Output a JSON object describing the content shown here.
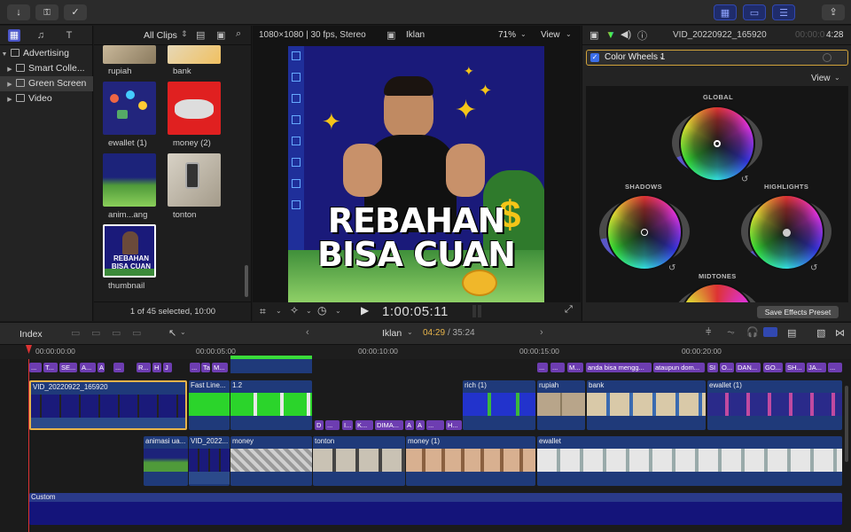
{
  "toolbar": {
    "import_icon": "arrow-down-icon",
    "keywords_icon": "key-icon",
    "check_icon": "checkmark-circle-icon",
    "share_icon": "share-icon"
  },
  "library": {
    "items": [
      {
        "label": "Advertising"
      },
      {
        "label": "Smart Colle..."
      },
      {
        "label": "Green Screen"
      },
      {
        "label": "Video"
      }
    ]
  },
  "browser": {
    "filter_label": "All Clips",
    "clips": [
      {
        "label": "rupiah"
      },
      {
        "label": "bank"
      },
      {
        "label": "ewallet (1)"
      },
      {
        "label": "money (2)"
      },
      {
        "label": "anim...ang"
      },
      {
        "label": "tonton"
      },
      {
        "label": "thumbnail"
      }
    ],
    "status": "1 of 45 selected, 10:00"
  },
  "viewer": {
    "format": "1080×1080 | 30 fps, Stereo",
    "project": "Iklan",
    "zoom": "71%",
    "view_label": "View",
    "timecode": "1:00:05:11",
    "frame_text_line1": "REBAHAN",
    "frame_text_line2": "BISA CUAN"
  },
  "inspector": {
    "clip_name": "VID_20220922_165920",
    "duration_dim": "00:00:0",
    "duration": "4:28",
    "effect_name": "Color Wheels 1",
    "view_label": "View",
    "wheel_global": "GLOBAL",
    "wheel_shadows": "SHADOWS",
    "wheel_highlights": "HIGHLIGHTS",
    "wheel_midtones": "MIDTONES",
    "save_preset": "Save Effects Preset"
  },
  "timeline": {
    "index_label": "Index",
    "project": "Iklan",
    "position": "04:29",
    "total": "/ 35:24",
    "ruler": [
      "00:00:00:00",
      "00:00:05:00",
      "00:00:10:00",
      "00:00:15:00",
      "00:00:20:00"
    ],
    "captions_top": [
      "...",
      "T...",
      "SE...",
      "A...",
      "A",
      "...",
      "R...",
      "H",
      "J",
      "...",
      "Ta",
      "M..."
    ],
    "captions_right": [
      "...",
      "...",
      "M...",
      "anda bisa mengg...",
      "ataupun dom...",
      "SI",
      "O...",
      "DAN...",
      "GO...",
      "SH...",
      "JA...",
      "..."
    ],
    "captions_mid": [
      "D",
      "...",
      "I...",
      "K...",
      "DIMA...",
      "A",
      "A",
      "...",
      "H..."
    ],
    "primary_clips": [
      {
        "title": "VID_20220922_165920"
      },
      {
        "title": "Fast Line..."
      },
      {
        "title": "1.2"
      },
      {
        "title": "rich (1)"
      },
      {
        "title": "rupiah"
      },
      {
        "title": "bank"
      },
      {
        "title": "ewallet (1)"
      }
    ],
    "lower_clips": [
      {
        "title": "animasi ua..."
      },
      {
        "title": "VID_2022..."
      },
      {
        "title": "money"
      },
      {
        "title": "tonton"
      },
      {
        "title": "money (1)"
      },
      {
        "title": "ewallet"
      }
    ],
    "custom_label": "Custom"
  },
  "colors": {
    "accent_blue": "#3148b0",
    "selection_gold": "#d1a33a",
    "caption_purple": "#6d3db1",
    "frame_blue": "#1a1a7a"
  }
}
